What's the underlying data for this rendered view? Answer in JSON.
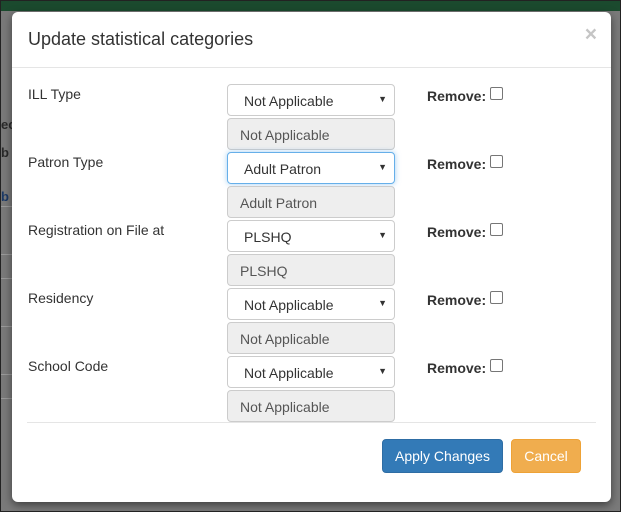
{
  "background": {
    "fragments": [
      "ec",
      "b",
      "b"
    ]
  },
  "modal": {
    "title": "Update statistical categories",
    "close_symbol": "×",
    "rows": [
      {
        "label": "ILL Type",
        "selected": "Not Applicable",
        "current": "Not Applicable",
        "remove_label": "Remove:",
        "remove_checked": false,
        "focused": false
      },
      {
        "label": "Patron Type",
        "selected": "Adult Patron",
        "current": "Adult Patron",
        "remove_label": "Remove:",
        "remove_checked": false,
        "focused": true
      },
      {
        "label": "Registration on File at",
        "selected": "PLSHQ",
        "current": "PLSHQ",
        "remove_label": "Remove:",
        "remove_checked": false,
        "focused": false
      },
      {
        "label": "Residency",
        "selected": "Not Applicable",
        "current": "Not Applicable",
        "remove_label": "Remove:",
        "remove_checked": false,
        "focused": false
      },
      {
        "label": "School Code",
        "selected": "Not Applicable",
        "current": "Not Applicable",
        "remove_label": "Remove:",
        "remove_checked": false,
        "focused": false
      }
    ],
    "apply_label": "Apply Changes",
    "cancel_label": "Cancel"
  },
  "colors": {
    "primary": "#337ab7",
    "warning": "#f0ad4e",
    "focus": "#66afe9"
  },
  "icons": {
    "close": "close-icon",
    "caret": "chevron-down-icon"
  }
}
